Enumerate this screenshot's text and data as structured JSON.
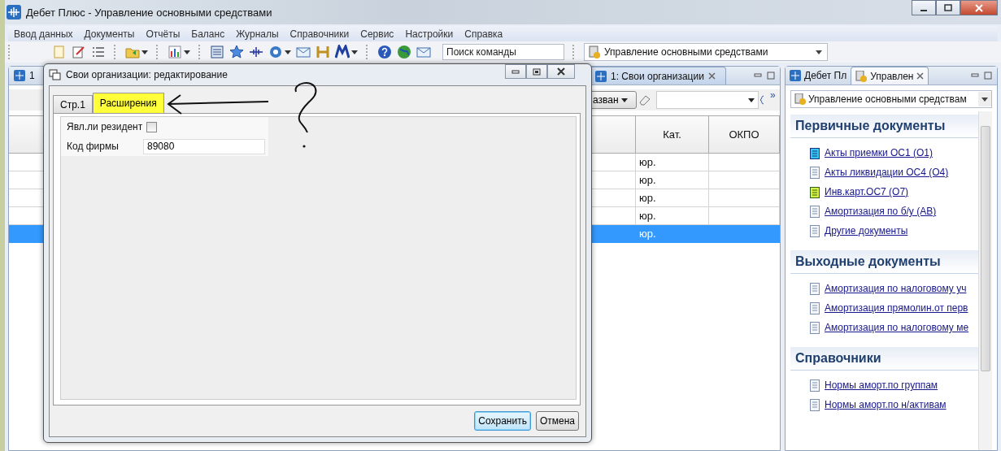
{
  "window": {
    "title": "Дебет Плюс - Управление основными средствами"
  },
  "menu": [
    "Ввод данных",
    "Документы",
    "Отчёты",
    "Баланс",
    "Журналы",
    "Справочники",
    "Сервис",
    "Настройки",
    "Справка"
  ],
  "toolbar": {
    "search": {
      "placeholder": "Поиск команды"
    },
    "perspective": "Управление основными средствами"
  },
  "editor": {
    "tab_fragment": "1",
    "tab": "1: Свои организации",
    "filter_button": "азван",
    "more": "»",
    "table": {
      "columns": [
        "Кат.",
        "ОКПО"
      ],
      "rows": [
        {
          "category": "юр.",
          "selected": false
        },
        {
          "category": "юр.",
          "selected": false
        },
        {
          "category": "юр.",
          "selected": false
        },
        {
          "category": "юр.",
          "selected": false
        },
        {
          "category": "юр.",
          "selected": true
        }
      ]
    }
  },
  "navigator": {
    "tabs": [
      {
        "label": "Дебет Пл",
        "selected": false
      },
      {
        "label": "Управлен",
        "selected": true
      }
    ],
    "combo": "Управление основными средствам",
    "sections": [
      {
        "title": "Первичные документы",
        "links": [
          {
            "label": "Акты приемки ОС1 (О1)",
            "kind": "pad_blue"
          },
          {
            "label": "Акты ликвидации ОС4 (О4)",
            "kind": "doc"
          },
          {
            "label": "Инв.карт.ОС7 (О7)",
            "kind": "pad_green"
          },
          {
            "label": "Амортизация по б/у (АВ)",
            "kind": "doc"
          },
          {
            "label": "Другие документы",
            "kind": "doc"
          }
        ]
      },
      {
        "title": "Выходные документы",
        "links": [
          {
            "label": "Амортизация по налоговому уч",
            "kind": "doc"
          },
          {
            "label": "Амортизация прямолин.от перв",
            "kind": "doc"
          },
          {
            "label": "Амортизация по налоговому ме",
            "kind": "doc"
          }
        ]
      },
      {
        "title": "Справочники",
        "links": [
          {
            "label": "Нормы аморт.по группам",
            "kind": "doc"
          },
          {
            "label": "Нормы аморт.по н/активам",
            "kind": "doc"
          }
        ]
      }
    ]
  },
  "dialog": {
    "title": "Свои организации: редактирование",
    "tabs": [
      {
        "label": "Стр.1",
        "selected": false,
        "highlighted": false
      },
      {
        "label": "Расширения",
        "selected": true,
        "highlighted": true
      }
    ],
    "fields": [
      {
        "kind": "checkbox",
        "label": "Явл.ли резидент",
        "checked": false
      },
      {
        "kind": "text",
        "label": "Код фирмы",
        "value": "89080"
      }
    ],
    "buttons": [
      {
        "label": "Сохранить",
        "default": true
      },
      {
        "label": "Отмена",
        "default": false
      }
    ]
  }
}
